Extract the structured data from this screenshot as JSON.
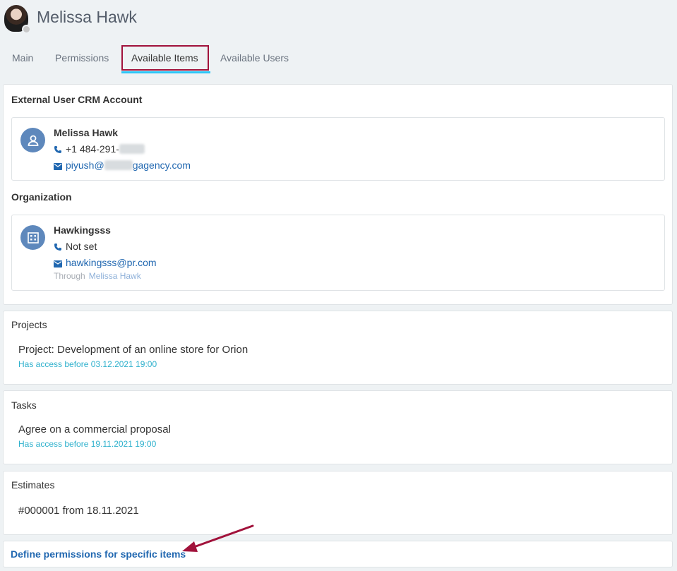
{
  "header": {
    "user_name": "Melissa Hawk"
  },
  "tabs": [
    {
      "label": "Main"
    },
    {
      "label": "Permissions"
    },
    {
      "label": "Available Items"
    },
    {
      "label": "Available Users"
    }
  ],
  "crm_section": {
    "title": "External User CRM Account",
    "contact": {
      "name": "Melissa Hawk",
      "phone_prefix": "+1 484-291-",
      "email_prefix": "piyush@",
      "email_suffix": "gagency.com"
    },
    "org_title": "Organization",
    "organization": {
      "name": "Hawkingsss",
      "phone": "Not set",
      "email": "hawkingsss@pr.com",
      "through_label": "Through",
      "through_name": "Melissa Hawk"
    }
  },
  "projects": {
    "title": "Projects",
    "items": [
      {
        "name": "Project: Development of an online store for Orion",
        "access": "Has access before 03.12.2021 19:00"
      }
    ]
  },
  "tasks": {
    "title": "Tasks",
    "items": [
      {
        "name": "Agree on a commercial proposal",
        "access": "Has access before 19.11.2021 19:00"
      }
    ]
  },
  "estimates": {
    "title": "Estimates",
    "items": [
      {
        "name": "#000001 from 18.11.2021"
      }
    ]
  },
  "footer": {
    "define_link": "Define permissions for specific items"
  },
  "colors": {
    "accent": "#2067b0",
    "tab_highlight": "#a1123b",
    "tab_underline": "#2fc6f6",
    "annotation_arrow": "#a1123b",
    "access_text": "#2fb1cd"
  },
  "icons": [
    "user-avatar",
    "person-icon",
    "phone-icon",
    "mail-icon",
    "building-icon",
    "arrow-annotation"
  ]
}
